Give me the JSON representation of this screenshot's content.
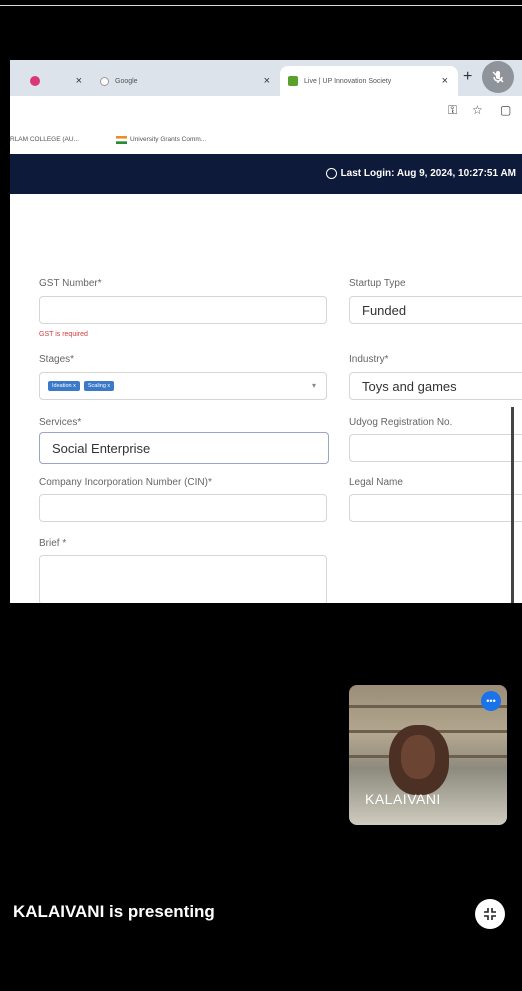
{
  "tabs": [
    {
      "label": ""
    },
    {
      "label": "Google"
    },
    {
      "label": "Live | UP Innovation Society"
    }
  ],
  "bookmarks": [
    {
      "label": "RLAM COLLEGE (AU..."
    },
    {
      "label": "University Grants Comm..."
    }
  ],
  "appbar": {
    "last_login": "Last Login: Aug 9, 2024, 10:27:51 AM"
  },
  "form": {
    "gst_label": "GST Number*",
    "gst_value": "",
    "gst_error": "GST is required",
    "startup_type_label": "Startup Type",
    "startup_type_value": "Funded",
    "stages_label": "Stages*",
    "stage_chips": [
      "Ideation x",
      "Scaling x"
    ],
    "industry_label": "Industry*",
    "industry_value": "Toys and games",
    "services_label": "Services*",
    "services_value": "Social Enterprise",
    "udyog_label": "Udyog Registration No.",
    "cin_label": "Company Incorporation Number (CIN)*",
    "legal_name_label": "Legal Name",
    "brief_label": "Brief *"
  },
  "meeting": {
    "participant_name": "KALAIVANI",
    "presenting_text": "KALAIVANI is presenting"
  },
  "icons": {
    "mic": "mic-off-icon",
    "clock": "clock-icon",
    "expand": "expand-icon"
  }
}
